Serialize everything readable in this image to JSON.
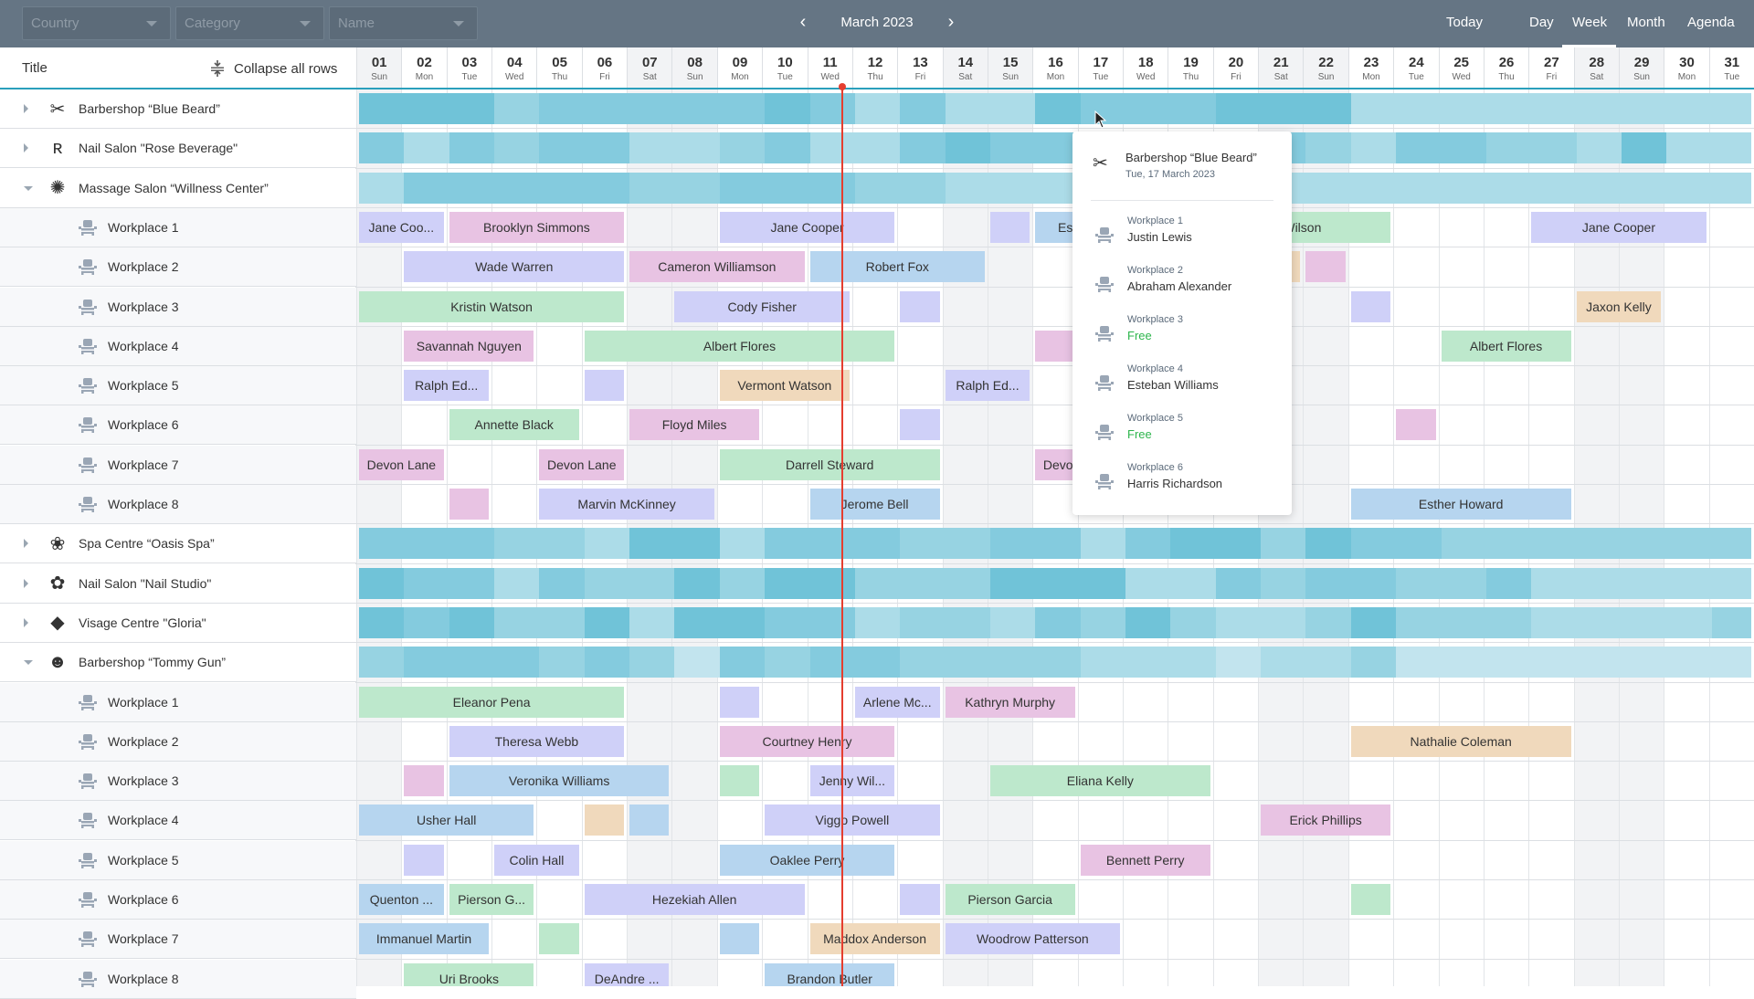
{
  "toolbar": {
    "filters": [
      {
        "name": "country",
        "placeholder": "Country"
      },
      {
        "name": "category",
        "placeholder": "Category"
      },
      {
        "name": "name",
        "placeholder": "Name"
      }
    ],
    "prev_icon": "‹",
    "next_icon": "›",
    "period_label": "March 2023",
    "today_label": "Today",
    "views": [
      "Day",
      "Week",
      "Month",
      "Agenda"
    ],
    "active_view": "Week"
  },
  "left_header": {
    "title": "Title",
    "collapse_label": "Collapse all rows"
  },
  "days": [
    {
      "num": "01",
      "dow": "Sun",
      "weekend": true
    },
    {
      "num": "02",
      "dow": "Mon",
      "weekend": false
    },
    {
      "num": "03",
      "dow": "Tue",
      "weekend": false
    },
    {
      "num": "04",
      "dow": "Wed",
      "weekend": false
    },
    {
      "num": "05",
      "dow": "Thu",
      "weekend": false
    },
    {
      "num": "06",
      "dow": "Fri",
      "weekend": false
    },
    {
      "num": "07",
      "dow": "Sat",
      "weekend": true
    },
    {
      "num": "08",
      "dow": "Sun",
      "weekend": true
    },
    {
      "num": "09",
      "dow": "Mon",
      "weekend": false
    },
    {
      "num": "10",
      "dow": "Tue",
      "weekend": false
    },
    {
      "num": "11",
      "dow": "Wed",
      "weekend": false
    },
    {
      "num": "12",
      "dow": "Thu",
      "weekend": false
    },
    {
      "num": "13",
      "dow": "Fri",
      "weekend": false
    },
    {
      "num": "14",
      "dow": "Sat",
      "weekend": true
    },
    {
      "num": "15",
      "dow": "Sun",
      "weekend": true
    },
    {
      "num": "16",
      "dow": "Mon",
      "weekend": false
    },
    {
      "num": "17",
      "dow": "Tue",
      "weekend": false
    },
    {
      "num": "18",
      "dow": "Wed",
      "weekend": false
    },
    {
      "num": "19",
      "dow": "Thu",
      "weekend": false
    },
    {
      "num": "20",
      "dow": "Fri",
      "weekend": false
    },
    {
      "num": "21",
      "dow": "Sat",
      "weekend": true
    },
    {
      "num": "22",
      "dow": "Sun",
      "weekend": true
    },
    {
      "num": "23",
      "dow": "Mon",
      "weekend": false
    },
    {
      "num": "24",
      "dow": "Tue",
      "weekend": false
    },
    {
      "num": "25",
      "dow": "Wed",
      "weekend": false
    },
    {
      "num": "26",
      "dow": "Thu",
      "weekend": false
    },
    {
      "num": "27",
      "dow": "Fri",
      "weekend": false
    },
    {
      "num": "28",
      "dow": "Sat",
      "weekend": true
    },
    {
      "num": "29",
      "dow": "Sun",
      "weekend": true
    },
    {
      "num": "30",
      "dow": "Mon",
      "weekend": false
    },
    {
      "num": "31",
      "dow": "Tue",
      "weekend": false
    }
  ],
  "current_day_index": 10,
  "event_colors": {
    "violet": "#cfd0f8",
    "pink": "#e8c3e3",
    "green": "#bde8cc",
    "blue": "#b6d5ef",
    "orange": "#f0d9bc"
  },
  "heat_colors": [
    "#c2e4ee",
    "#acdce8",
    "#97d3e2",
    "#84cbde",
    "#70c3d8"
  ],
  "rows": [
    {
      "type": "group",
      "label": "Barbershop “Blue Beard”",
      "icon": "barber-logo-icon",
      "glyph": "✂",
      "expanded": false,
      "load": [
        4,
        4,
        4,
        2,
        3,
        3,
        3,
        3,
        3,
        4,
        3,
        1,
        3,
        1,
        1,
        4,
        3,
        3,
        3,
        4,
        4,
        4,
        1,
        1,
        1,
        1,
        1,
        1,
        1,
        1,
        1
      ]
    },
    {
      "type": "group",
      "label": "Nail Salon \"Rose Beverage\"",
      "icon": "rose-logo-icon",
      "glyph": "ʀ",
      "expanded": false,
      "load": [
        3,
        1,
        3,
        2,
        3,
        3,
        1,
        1,
        2,
        3,
        1,
        1,
        3,
        4,
        3,
        3,
        1,
        1,
        1,
        3,
        3,
        2,
        1,
        3,
        3,
        2,
        2,
        1,
        4,
        1,
        1
      ]
    },
    {
      "type": "group",
      "label": "Massage Salon “Willness Center”",
      "icon": "massage-logo-icon",
      "glyph": "✺",
      "expanded": true,
      "load": [
        1,
        3,
        3,
        3,
        3,
        3,
        2,
        2,
        3,
        3,
        3,
        2,
        2,
        1,
        1,
        1,
        1,
        1,
        1,
        1,
        1,
        1,
        1,
        1,
        1,
        1,
        1,
        1,
        1,
        1,
        1
      ]
    },
    {
      "type": "child",
      "label": "Workplace 1",
      "events": [
        {
          "start": 1,
          "end": 2,
          "label": "Jane Coo...",
          "color": "violet"
        },
        {
          "start": 3,
          "end": 6,
          "label": "Brooklyn Simmons",
          "color": "pink"
        },
        {
          "start": 9,
          "end": 12,
          "label": "Jane Cooper",
          "color": "violet"
        },
        {
          "start": 15,
          "end": 15,
          "label": "",
          "color": "violet"
        },
        {
          "start": 16,
          "end": 18,
          "label": "Esther Howard",
          "color": "blue"
        },
        {
          "start": 19,
          "end": 23,
          "label": "Wendy Wilson",
          "color": "green"
        },
        {
          "start": 27,
          "end": 30,
          "label": "Jane Cooper",
          "color": "violet"
        }
      ]
    },
    {
      "type": "child",
      "label": "Workplace 2",
      "events": [
        {
          "start": 2,
          "end": 6,
          "label": "Wade Warren",
          "color": "violet"
        },
        {
          "start": 7,
          "end": 10,
          "label": "Cameron Williamson",
          "color": "pink"
        },
        {
          "start": 11,
          "end": 14,
          "label": "Robert Fox",
          "color": "blue"
        },
        {
          "start": 21,
          "end": 21,
          "label": "",
          "color": "orange"
        },
        {
          "start": 22,
          "end": 22,
          "label": "",
          "color": "pink"
        }
      ]
    },
    {
      "type": "child",
      "label": "Workplace 3",
      "events": [
        {
          "start": 1,
          "end": 6,
          "label": "Kristin Watson",
          "color": "green"
        },
        {
          "start": 8,
          "end": 11,
          "label": "Cody Fisher",
          "color": "violet"
        },
        {
          "start": 13,
          "end": 13,
          "label": "",
          "color": "violet"
        },
        {
          "start": 23,
          "end": 23,
          "label": "",
          "color": "violet"
        },
        {
          "start": 28,
          "end": 29,
          "label": "Jaxon Kelly",
          "color": "orange"
        }
      ]
    },
    {
      "type": "child",
      "label": "Workplace 4",
      "events": [
        {
          "start": 2,
          "end": 4,
          "label": "Savannah Nguyen",
          "color": "pink"
        },
        {
          "start": 6,
          "end": 12,
          "label": "Albert Flores",
          "color": "green"
        },
        {
          "start": 16,
          "end": 17,
          "label": "",
          "color": "pink"
        },
        {
          "start": 25,
          "end": 27,
          "label": "Albert Flores",
          "color": "green"
        }
      ]
    },
    {
      "type": "child",
      "label": "Workplace 5",
      "events": [
        {
          "start": 2,
          "end": 3,
          "label": "Ralph Ed...",
          "color": "violet"
        },
        {
          "start": 6,
          "end": 6,
          "label": "",
          "color": "violet"
        },
        {
          "start": 9,
          "end": 11,
          "label": "Vermont Watson",
          "color": "orange"
        },
        {
          "start": 14,
          "end": 15,
          "label": "Ralph Ed...",
          "color": "violet"
        }
      ]
    },
    {
      "type": "child",
      "label": "Workplace 6",
      "events": [
        {
          "start": 3,
          "end": 5,
          "label": "Annette Black",
          "color": "green"
        },
        {
          "start": 7,
          "end": 9,
          "label": "Floyd Miles",
          "color": "pink"
        },
        {
          "start": 13,
          "end": 13,
          "label": "",
          "color": "violet"
        },
        {
          "start": 24,
          "end": 24,
          "label": "",
          "color": "pink"
        }
      ]
    },
    {
      "type": "child",
      "label": "Workplace 7",
      "events": [
        {
          "start": 1,
          "end": 2,
          "label": "Devon Lane",
          "color": "pink"
        },
        {
          "start": 5,
          "end": 6,
          "label": "Devon Lane",
          "color": "pink"
        },
        {
          "start": 9,
          "end": 13,
          "label": "Darrell Steward",
          "color": "green"
        },
        {
          "start": 16,
          "end": 17,
          "label": "Devon Lane",
          "color": "pink"
        }
      ]
    },
    {
      "type": "child",
      "label": "Workplace 8",
      "events": [
        {
          "start": 3,
          "end": 3,
          "label": "",
          "color": "pink"
        },
        {
          "start": 5,
          "end": 8,
          "label": "Marvin McKinney",
          "color": "violet"
        },
        {
          "start": 11,
          "end": 13,
          "label": "Jerome Bell",
          "color": "blue"
        },
        {
          "start": 23,
          "end": 27,
          "label": "Esther Howard",
          "color": "blue"
        }
      ]
    },
    {
      "type": "group",
      "label": "Spa Centre “Oasis Spa”",
      "icon": "spa-logo-icon",
      "glyph": "❀",
      "expanded": false,
      "load": [
        3,
        3,
        3,
        2,
        2,
        1,
        4,
        4,
        1,
        3,
        3,
        3,
        2,
        2,
        3,
        3,
        1,
        3,
        4,
        4,
        2,
        4,
        3,
        3,
        2,
        2,
        2,
        2,
        2,
        2,
        2
      ]
    },
    {
      "type": "group",
      "label": "Nail Salon \"Nail Studio\"",
      "icon": "nail-studio-logo-icon",
      "glyph": "✿",
      "expanded": false,
      "load": [
        4,
        3,
        3,
        1,
        3,
        2,
        2,
        4,
        2,
        4,
        4,
        2,
        2,
        2,
        4,
        4,
        4,
        1,
        1,
        3,
        2,
        3,
        3,
        2,
        2,
        3,
        1,
        1,
        1,
        1,
        1
      ]
    },
    {
      "type": "group",
      "label": "Visage Centre \"Gloria\"",
      "icon": "gloria-logo-icon",
      "glyph": "◆",
      "expanded": false,
      "load": [
        4,
        3,
        4,
        2,
        2,
        4,
        1,
        4,
        4,
        3,
        3,
        1,
        2,
        2,
        1,
        3,
        2,
        4,
        2,
        1,
        1,
        2,
        4,
        2,
        2,
        2,
        1,
        1,
        1,
        1,
        2
      ]
    },
    {
      "type": "group",
      "label": "Barbershop “Tommy Gun”",
      "icon": "tommy-gun-logo-icon",
      "glyph": "☻",
      "expanded": true,
      "load": [
        2,
        3,
        3,
        3,
        2,
        3,
        2,
        0,
        3,
        2,
        3,
        3,
        2,
        2,
        2,
        2,
        1,
        1,
        1,
        0,
        1,
        1,
        2,
        0,
        0,
        0,
        0,
        0,
        0,
        0,
        0
      ]
    },
    {
      "type": "child",
      "label": "Workplace 1",
      "events": [
        {
          "start": 1,
          "end": 6,
          "label": "Eleanor Pena",
          "color": "green"
        },
        {
          "start": 9,
          "end": 9,
          "label": "",
          "color": "violet"
        },
        {
          "start": 12,
          "end": 13,
          "label": "Arlene Mc...",
          "color": "violet"
        },
        {
          "start": 14,
          "end": 16,
          "label": "Kathryn Murphy",
          "color": "pink"
        }
      ]
    },
    {
      "type": "child",
      "label": "Workplace 2",
      "events": [
        {
          "start": 3,
          "end": 6,
          "label": "Theresa Webb",
          "color": "violet"
        },
        {
          "start": 9,
          "end": 12,
          "label": "Courtney Henry",
          "color": "pink"
        },
        {
          "start": 23,
          "end": 27,
          "label": "Nathalie Coleman",
          "color": "orange"
        }
      ]
    },
    {
      "type": "child",
      "label": "Workplace 3",
      "events": [
        {
          "start": 2,
          "end": 2,
          "label": "",
          "color": "pink"
        },
        {
          "start": 3,
          "end": 7,
          "label": "Veronika Williams",
          "color": "blue"
        },
        {
          "start": 9,
          "end": 9,
          "label": "",
          "color": "green"
        },
        {
          "start": 11,
          "end": 12,
          "label": "Jenny Wil...",
          "color": "violet"
        },
        {
          "start": 15,
          "end": 19,
          "label": "Eliana Kelly",
          "color": "green"
        }
      ]
    },
    {
      "type": "child",
      "label": "Workplace 4",
      "events": [
        {
          "start": 1,
          "end": 4,
          "label": "Usher Hall",
          "color": "blue"
        },
        {
          "start": 6,
          "end": 6,
          "label": "",
          "color": "orange"
        },
        {
          "start": 7,
          "end": 7,
          "label": "",
          "color": "blue"
        },
        {
          "start": 10,
          "end": 13,
          "label": "Viggo Powell",
          "color": "violet"
        },
        {
          "start": 21,
          "end": 23,
          "label": "Erick Phillips",
          "color": "pink"
        }
      ]
    },
    {
      "type": "child",
      "label": "Workplace 5",
      "events": [
        {
          "start": 2,
          "end": 2,
          "label": "",
          "color": "violet"
        },
        {
          "start": 4,
          "end": 5,
          "label": "Colin Hall",
          "color": "violet"
        },
        {
          "start": 9,
          "end": 12,
          "label": "Oaklee Perry",
          "color": "blue"
        },
        {
          "start": 17,
          "end": 19,
          "label": "Bennett Perry",
          "color": "pink"
        }
      ]
    },
    {
      "type": "child",
      "label": "Workplace 6",
      "events": [
        {
          "start": 1,
          "end": 2,
          "label": "Quenton ...",
          "color": "blue"
        },
        {
          "start": 3,
          "end": 4,
          "label": "Pierson G...",
          "color": "green"
        },
        {
          "start": 6,
          "end": 10,
          "label": "Hezekiah Allen",
          "color": "violet"
        },
        {
          "start": 13,
          "end": 13,
          "label": "",
          "color": "violet"
        },
        {
          "start": 14,
          "end": 16,
          "label": "Pierson Garcia",
          "color": "green"
        },
        {
          "start": 23,
          "end": 23,
          "label": "",
          "color": "green"
        }
      ]
    },
    {
      "type": "child",
      "label": "Workplace 7",
      "events": [
        {
          "start": 1,
          "end": 3,
          "label": "Immanuel Martin",
          "color": "blue"
        },
        {
          "start": 5,
          "end": 5,
          "label": "",
          "color": "green"
        },
        {
          "start": 9,
          "end": 9,
          "label": "",
          "color": "blue"
        },
        {
          "start": 11,
          "end": 13,
          "label": "Maddox Anderson",
          "color": "orange"
        },
        {
          "start": 14,
          "end": 17,
          "label": "Woodrow Patterson",
          "color": "violet"
        }
      ]
    },
    {
      "type": "child",
      "label": "Workplace 8",
      "events": [
        {
          "start": 2,
          "end": 4,
          "label": "Uri Brooks",
          "color": "green"
        },
        {
          "start": 6,
          "end": 7,
          "label": "DeAndre ...",
          "color": "violet"
        },
        {
          "start": 10,
          "end": 12,
          "label": "Brandon Butler",
          "color": "blue"
        }
      ]
    }
  ],
  "tooltip": {
    "title": "Barbershop “Blue Beard”",
    "date": "Tue, 17 March 2023",
    "items": [
      {
        "workplace": "Workplace 1",
        "who": "Justin Lewis",
        "free": false
      },
      {
        "workplace": "Workplace 2",
        "who": "Abraham Alexander",
        "free": false
      },
      {
        "workplace": "Workplace 3",
        "who": "Free",
        "free": true
      },
      {
        "workplace": "Workplace 4",
        "who": "Esteban Williams",
        "free": false
      },
      {
        "workplace": "Workplace 5",
        "who": "Free",
        "free": true
      },
      {
        "workplace": "Workplace 6",
        "who": "Harris Richardson",
        "free": false
      }
    ]
  }
}
